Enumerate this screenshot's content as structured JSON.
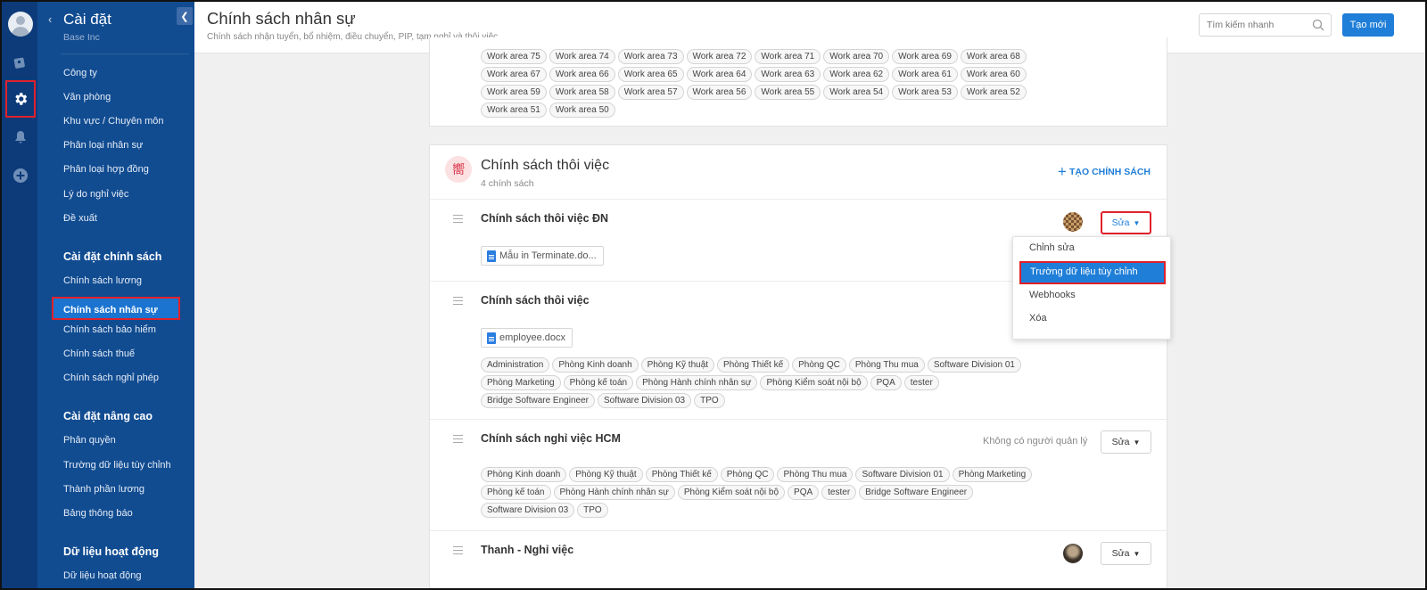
{
  "nav": {
    "title": "Cài đặt",
    "company": "Base Inc",
    "items_top": [
      "Công ty",
      "Văn phòng",
      "Khu vực / Chuyên môn",
      "Phân loại nhân sự",
      "Phân loại hợp đồng",
      "Lý do nghỉ việc",
      "Đề xuất"
    ],
    "section_policy": "Cài đặt chính sách",
    "items_policy": [
      "Chính sách lương",
      "Chính sách nhân sự",
      "Chính sách bảo hiểm",
      "Chính sách thuế",
      "Chính sách nghỉ phép"
    ],
    "section_advanced": "Cài đặt nâng cao",
    "items_advanced": [
      "Phân quyền",
      "Trường dữ liệu tùy chỉnh",
      "Thành phần lương",
      "Bảng thông báo"
    ],
    "section_activity": "Dữ liệu hoạt động",
    "items_activity": [
      "Dữ liệu hoạt động"
    ]
  },
  "header": {
    "title": "Chính sách nhân sự",
    "subtitle": "Chính sách nhận tuyển, bổ nhiệm, điều chuyển, PIP, tạm nghỉ và thôi việc",
    "search_placeholder": "Tìm kiếm nhanh",
    "new_button": "Tạo mới"
  },
  "work_areas": {
    "row1": [
      "Work area 75",
      "Work area 74",
      "Work area 73",
      "Work area 72",
      "Work area 71",
      "Work area 70",
      "Work area 69",
      "Work area 68"
    ],
    "row2": [
      "Work area 67",
      "Work area 66",
      "Work area 65",
      "Work area 64",
      "Work area 63",
      "Work area 62",
      "Work area 61",
      "Work area 60"
    ],
    "row3": [
      "Work area 59",
      "Work area 58",
      "Work area 57",
      "Work area 56",
      "Work area 55",
      "Work area 54",
      "Work area 53",
      "Work area 52"
    ],
    "row4": [
      "Work area 51",
      "Work area 50"
    ]
  },
  "section": {
    "icon": "merge-icon",
    "title": "Chính sách thôi việc",
    "count": "4 chính sách",
    "create": "TẠO CHÍNH SÁCH"
  },
  "policies": [
    {
      "title": "Chính sách thôi việc ĐN",
      "file": "Mẫu in Terminate.do...",
      "edit": "Sửa"
    },
    {
      "title": "Chính sách thôi việc",
      "file": "employee.docx",
      "tags_r1": [
        "Administration",
        "Phòng Kinh doanh",
        "Phòng Kỹ thuật",
        "Phòng Thiết kế",
        "Phòng QC",
        "Phòng Thu mua",
        "Software Division 01"
      ],
      "tags_r2": [
        "Phòng Marketing",
        "Phòng kế toán",
        "Phòng Hành chính nhân sự",
        "Phòng Kiểm soát nội bộ",
        "PQA",
        "tester"
      ],
      "tags_r3": [
        "Bridge Software Engineer",
        "Software Division 03",
        "TPO"
      ]
    },
    {
      "title": "Chính sách nghỉ việc HCM",
      "no_manager": "Không có người quản lý",
      "edit": "Sửa",
      "tags_r1": [
        "Phòng Kinh doanh",
        "Phòng Kỹ thuật",
        "Phòng Thiết kế",
        "Phòng QC",
        "Phòng Thu mua",
        "Software Division 01",
        "Phòng Marketing"
      ],
      "tags_r2": [
        "Phòng kế toán",
        "Phòng Hành chính nhân sự",
        "Phòng Kiểm soát nội bộ",
        "PQA",
        "tester",
        "Bridge Software Engineer"
      ],
      "tags_r3": [
        "Software Division 03",
        "TPO"
      ]
    },
    {
      "title": "Thanh - Nghỉ việc",
      "edit": "Sửa"
    }
  ],
  "menu": {
    "items": [
      "Chỉnh sửa",
      "Trường dữ liệu tùy chỉnh",
      "Webhooks",
      "Xóa"
    ]
  },
  "colors": {
    "sidebar": "#114c91",
    "rail": "#0d3b7a",
    "accent": "#1f7ed8",
    "highlight": "#e0212a"
  }
}
